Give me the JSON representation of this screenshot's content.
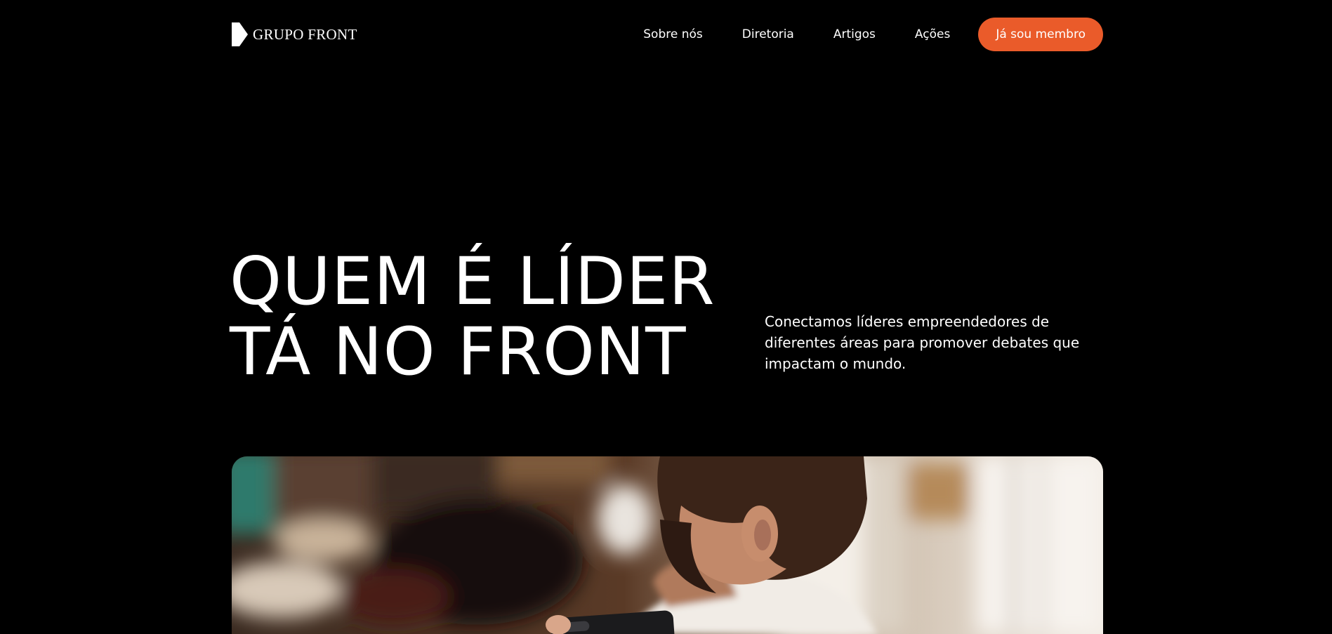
{
  "header": {
    "logo_text": "GRUPO FRONT",
    "nav": [
      {
        "label": "Sobre nós"
      },
      {
        "label": "Diretoria"
      },
      {
        "label": "Artigos"
      },
      {
        "label": "Ações"
      }
    ],
    "cta_label": "Já sou membro"
  },
  "hero": {
    "title_line_1": "QUEM É LÍDER",
    "title_line_2": "TÁ NO FRONT",
    "description": "Conectamos líderes empreendedores de diferentes áreas para promover debates que impactam o mundo."
  },
  "colors": {
    "background": "#000000",
    "accent": "#ea5b2a",
    "text": "#ffffff"
  },
  "icons": {
    "logo_mark": "front-logo-icon"
  }
}
